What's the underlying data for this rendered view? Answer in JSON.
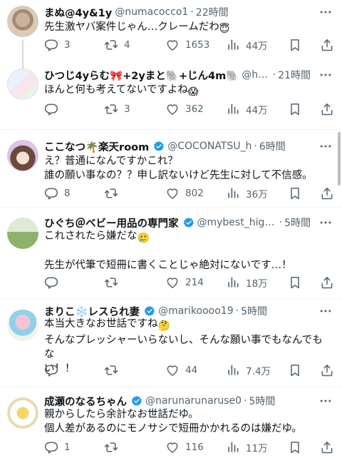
{
  "tweets": [
    {
      "name": "まぬ@4y&1y",
      "handle": "@numacocco1",
      "time": "22時間",
      "text": "先生激ヤバ案件じゃん…クレームだわ",
      "emoji": "😇",
      "verified": false,
      "replies": "3",
      "retweets": "4",
      "likes": "1653",
      "views": "44万"
    },
    {
      "name": "ひつじ4yらむ🎀+2yまと🐘+じん4m🐘",
      "handle": "@hit...",
      "time": "21時間",
      "text": "ほんと何も考えてないですよね",
      "emoji": "😱",
      "verified": false,
      "replies": "",
      "retweets": "3",
      "likes": "362",
      "views": "44万"
    },
    {
      "name": "ここなつ🌴楽天room",
      "handle": "@COCONATSU_h",
      "time": "6時間",
      "text1": "え？普通になんですかこれ？",
      "text2": "誰の願い事なの？？申し訳ないけど先生に対して不信感。",
      "verified": true,
      "replies": "8",
      "retweets": "",
      "likes": "802",
      "views": "36万"
    },
    {
      "name": "ひぐち＠ベビー用品の専門家",
      "handle": "@mybest_higuchi",
      "time": "5時間",
      "text1": "これされたら嫌だな",
      "emoji": "🥲",
      "text2": "先生が代筆で短冊に書くことじゃ絶対にないです…！",
      "verified": true,
      "replies": "",
      "retweets": "",
      "likes": "214",
      "views": "18万"
    },
    {
      "name": "まりこ❄️レスられ妻",
      "handle": "@marikoooo19",
      "time": "5時間",
      "text1": "本当大きなお世話ですね",
      "emoji": "🤔",
      "text2": "そんなプレッシャーいらないし、そんな願い事でもなんでもな",
      "text3": "い！！",
      "verified": true,
      "replies": "",
      "retweets": "",
      "likes": "44",
      "views": "7.4万"
    },
    {
      "name": "成瀬のなるちゃん",
      "handle": "@narunarunaruse0",
      "time": "5時間",
      "text1": "親からしたら余計なお世話だゆ。",
      "text2": "個人差があるのにモノサシで短冊かかれるのは嫌だゆ。",
      "verified": true,
      "replies": "1",
      "retweets": "",
      "likes": "116",
      "views": "11万"
    }
  ],
  "sep": "·",
  "colors": {
    "verified": "#1d9bf0",
    "icon": "#536471",
    "text": "#0f1419",
    "divider": "#eff3f4"
  }
}
